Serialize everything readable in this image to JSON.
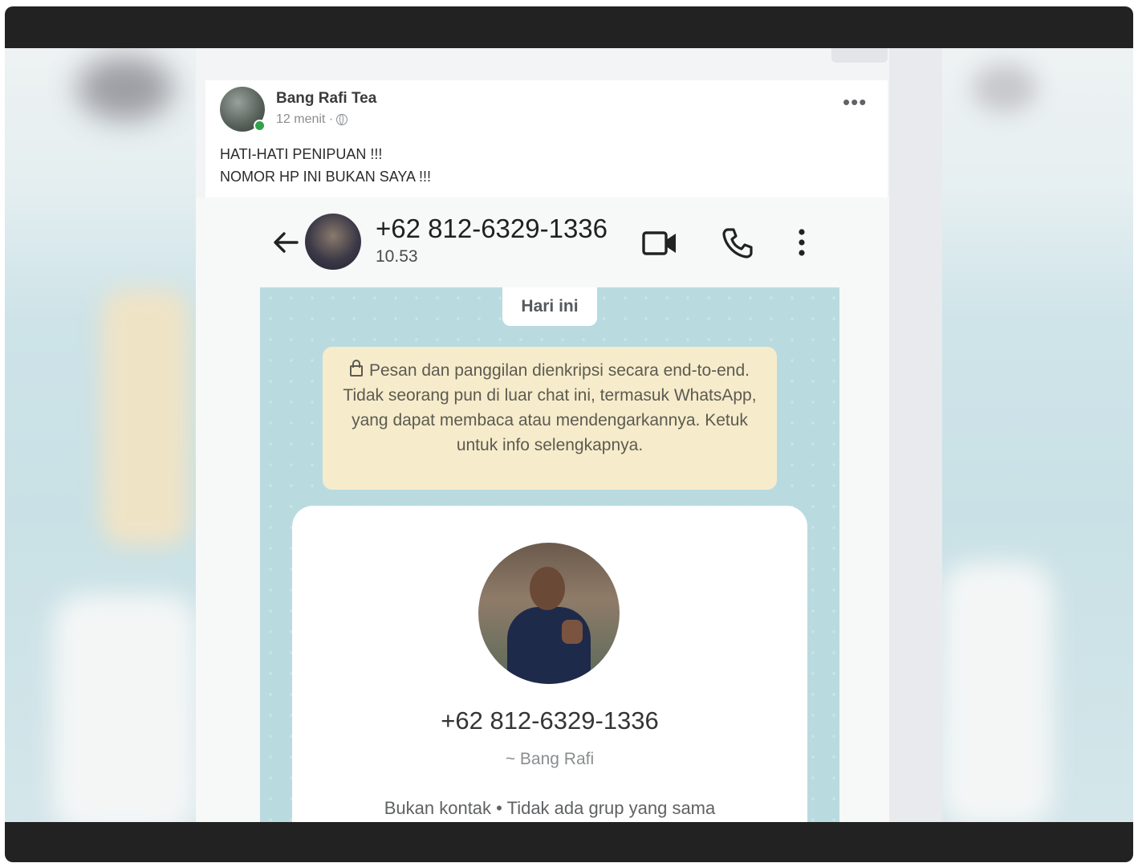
{
  "post": {
    "author": "Bang Rafi Tea",
    "time": "12 menit ·",
    "more_icon": "•••",
    "line1": "HATI-HATI PENIPUAN !!!",
    "line2": "NOMOR HP INI BUKAN SAYA !!!"
  },
  "chat_header": {
    "number": "+62 812-6329-1336",
    "time": "10.53"
  },
  "chat": {
    "day_label": "Hari ini",
    "encryption_notice": "Pesan dan panggilan dienkripsi secara end-to-end. Tidak seorang pun di luar chat ini, termasuk WhatsApp, yang dapat membaca atau mendengarkannya. Ketuk untuk info selengkapnya.",
    "contact_card": {
      "number": "+62 812-6329-1336",
      "name": "~ Bang Rafi",
      "info": "Bukan kontak • Tidak ada grup yang sama"
    }
  },
  "icons": {
    "back": "arrow-left-icon",
    "video": "video-call-icon",
    "phone": "phone-icon",
    "menu": "more-vertical-icon",
    "lock": "lock-icon",
    "globe": "globe-icon"
  }
}
